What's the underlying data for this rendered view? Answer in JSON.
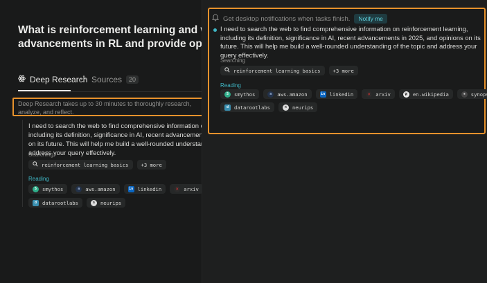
{
  "question": "What is reinforcement learning and why is it important? Capture recent advancements in RL and provide opinions on the future of RL.",
  "tabs": {
    "deep_research": "Deep Research",
    "sources": "Sources",
    "sources_count": "20"
  },
  "note": "Deep Research takes up to 30 minutes to thoroughly research, analyze, and reflect.",
  "step": {
    "text": "I need to search the web to find comprehensive information on reinforcement learning, including its definition, significance in AI, recent advancements in 2025, and opinions on its future. This will help me build a well-rounded understanding of the topic and address your query effectively.",
    "searching_label": "Searching",
    "query": "reinforcement learning basics",
    "more": "+3 more",
    "reading_label": "Reading",
    "sources": [
      {
        "name": "smythos",
        "icon": "smythos-icon"
      },
      {
        "name": "aws.amazon",
        "icon": "aws-icon"
      },
      {
        "name": "linkedin",
        "icon": "linkedin-icon"
      },
      {
        "name": "arxiv",
        "icon": "arxiv-icon"
      },
      {
        "name": "en.wikipedia",
        "icon": "wikipedia-icon"
      },
      {
        "name": "synopsys",
        "icon": "synopsys-icon"
      },
      {
        "name": "datarootlabs",
        "icon": "datarootlabs-icon"
      },
      {
        "name": "neurips",
        "icon": "neurips-icon"
      }
    ]
  },
  "notify": {
    "text": "Get desktop notifications when tasks finish.",
    "button": "Notify me"
  },
  "colors": {
    "accent": "#3fb6c4",
    "highlight_border": "#e8922c",
    "background": "#191a1a"
  }
}
